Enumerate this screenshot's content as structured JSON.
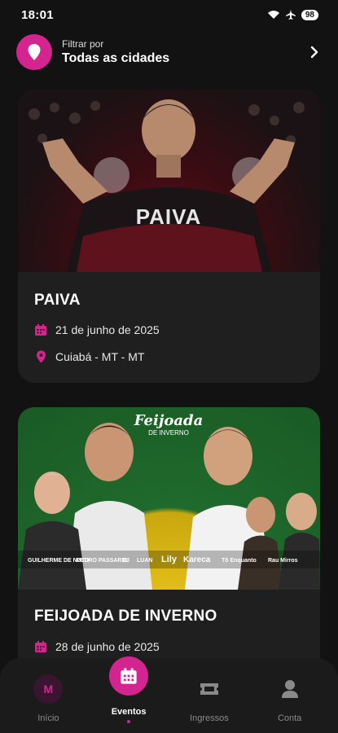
{
  "status_bar": {
    "time": "18:01",
    "battery": "98"
  },
  "filter": {
    "caption": "Filtrar por",
    "value": "Todas as cidades"
  },
  "events": [
    {
      "title": "PAIVA",
      "date": "21 de junho de 2025",
      "location": "Cuiabá - MT - MT",
      "jersey_text": "PAIVA"
    },
    {
      "title": "FEIJOADA DE INVERNO",
      "date": "28 de junho de 2025",
      "logo_text": "Feijoada",
      "logo_sub": "DE INVERNO",
      "artist_labels": [
        "GUILHERME DE NUTO",
        "PEDRO PASSARIO",
        "DJ",
        "LUAN",
        "Lily",
        "Kareca",
        "Tô Enquanto",
        "Rau Mirros"
      ]
    }
  ],
  "nav": {
    "items": [
      {
        "label": "Início",
        "avatar": "M"
      },
      {
        "label": "Eventos"
      },
      {
        "label": "Ingressos"
      },
      {
        "label": "Conta"
      }
    ]
  },
  "colors": {
    "accent": "#d4248f",
    "background": "#121212",
    "card": "#1f1f1f"
  }
}
